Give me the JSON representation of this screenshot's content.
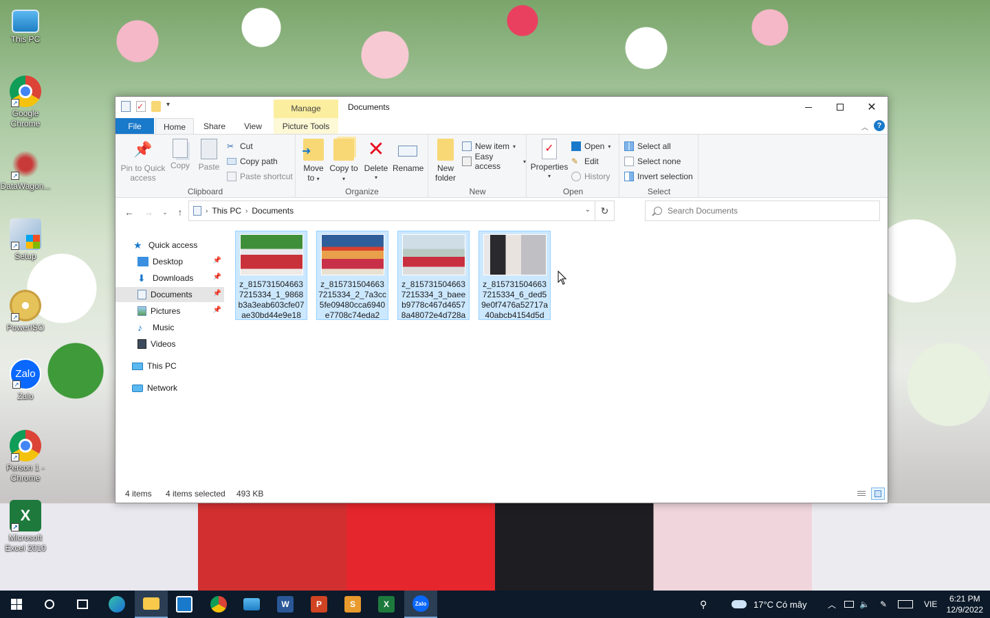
{
  "desktop": {
    "icons": [
      {
        "label": "This PC"
      },
      {
        "label": "Google Chrome"
      },
      {
        "label": "DataWagon..."
      },
      {
        "label": "Setup"
      },
      {
        "label": "PowerISO"
      },
      {
        "label": "Zalo"
      },
      {
        "label": "Person 1 - Chrome"
      },
      {
        "label": "Microsoft Excel 2010"
      }
    ]
  },
  "window": {
    "title": "Documents",
    "context_tab": "Manage",
    "tabs": {
      "file": "File",
      "home": "Home",
      "share": "Share",
      "view": "View",
      "picture_tools": "Picture Tools"
    },
    "ribbon": {
      "clipboard": {
        "label": "Clipboard",
        "pin": "Pin to Quick access",
        "copy": "Copy",
        "paste": "Paste",
        "cut": "Cut",
        "copy_path": "Copy path",
        "paste_shortcut": "Paste shortcut"
      },
      "organize": {
        "label": "Organize",
        "move_to": "Move to",
        "copy_to": "Copy to",
        "delete": "Delete",
        "rename": "Rename"
      },
      "new": {
        "label": "New",
        "new_folder": "New folder",
        "new_item": "New item",
        "easy_access": "Easy access"
      },
      "open": {
        "label": "Open",
        "properties": "Properties",
        "open": "Open",
        "edit": "Edit",
        "history": "History"
      },
      "select": {
        "label": "Select",
        "select_all": "Select all",
        "select_none": "Select none",
        "invert": "Invert selection"
      }
    },
    "address": {
      "crumbs": [
        "This PC",
        "Documents"
      ]
    },
    "search": {
      "placeholder": "Search Documents"
    },
    "nav": {
      "quick_access": "Quick access",
      "desktop": "Desktop",
      "downloads": "Downloads",
      "documents": "Documents",
      "pictures": "Pictures",
      "music": "Music",
      "videos": "Videos",
      "this_pc": "This PC",
      "network": "Network"
    },
    "files": [
      {
        "name": "z_8157315046637215334_1_9868b3a3eab603cfe07ae30bd44e9e18"
      },
      {
        "name": "z_8157315046637215334_2_7a3cc5fe09480cca6940e7708c74eda2"
      },
      {
        "name": "z_8157315046637215334_3_baeeb9778c467d46578a48072e4d728a"
      },
      {
        "name": "z_8157315046637215334_6_ded59e0f7476a52717a40abcb4154d5d"
      }
    ],
    "status": {
      "items": "4 items",
      "selected": "4 items selected",
      "size": "493 KB"
    }
  },
  "taskbar": {
    "weather": "17°C  Có mây",
    "language": "VIE",
    "time": "6:21 PM",
    "date": "12/9/2022"
  },
  "colors": {
    "accent": "#1979ca",
    "selection": "#cce8ff",
    "manage_tab": "#fcee9f",
    "taskbar": "#0c1a2a"
  }
}
